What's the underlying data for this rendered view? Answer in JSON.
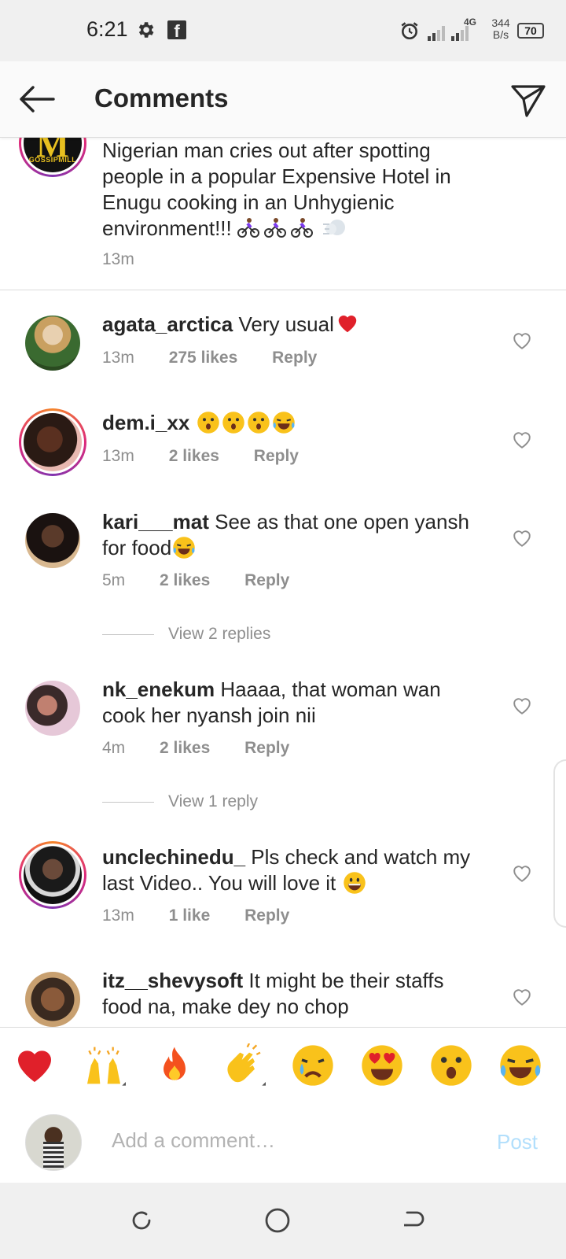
{
  "status_bar": {
    "time": "6:21",
    "network_type": "4G",
    "speed_value": "344",
    "speed_unit": "B/s",
    "battery": "70"
  },
  "header": {
    "title": "Comments"
  },
  "caption": {
    "text": "Nigerian man cries out after spotting people in a popular Expensive Hotel in Enugu cooking in an Unhygienic environment!!!",
    "time": "13m",
    "avatar_letter": "M",
    "avatar_banner": "GOSSIPMILL"
  },
  "comments": [
    {
      "username": "agata_arctica",
      "text": "Very usual",
      "time": "13m",
      "likes": "275 likes",
      "reply": "Reply"
    },
    {
      "username": "dem.i_xx",
      "text": "",
      "time": "13m",
      "likes": "2 likes",
      "reply": "Reply"
    },
    {
      "username": "kari___mat",
      "text": "See as that one open yansh for food",
      "time": "5m",
      "likes": "2 likes",
      "reply": "Reply",
      "view_replies": "View 2 replies"
    },
    {
      "username": "nk_enekum",
      "text": "Haaaa, that woman wan cook her nyansh join nii",
      "time": "4m",
      "likes": "2 likes",
      "reply": "Reply",
      "view_replies": "View 1 reply"
    },
    {
      "username": "unclechinedu_",
      "text": "Pls check and watch my last Video.. You will love it",
      "time": "13m",
      "likes": "1 like",
      "reply": "Reply"
    },
    {
      "username": "itz__shevysoft",
      "text": "It might be their staffs food na, make dey no chop",
      "time": "",
      "likes": "",
      "reply": ""
    }
  ],
  "emoji_bar": [
    "heart",
    "raising-hands",
    "fire",
    "clapping-hands",
    "crying-face",
    "heart-eyes",
    "surprised-face",
    "tears-of-joy"
  ],
  "comment_input": {
    "placeholder": "Add a comment…",
    "post_label": "Post"
  },
  "colors": {
    "link_post": "#b2dffc",
    "meta_gray": "#8e8e8e",
    "text": "#262626"
  }
}
